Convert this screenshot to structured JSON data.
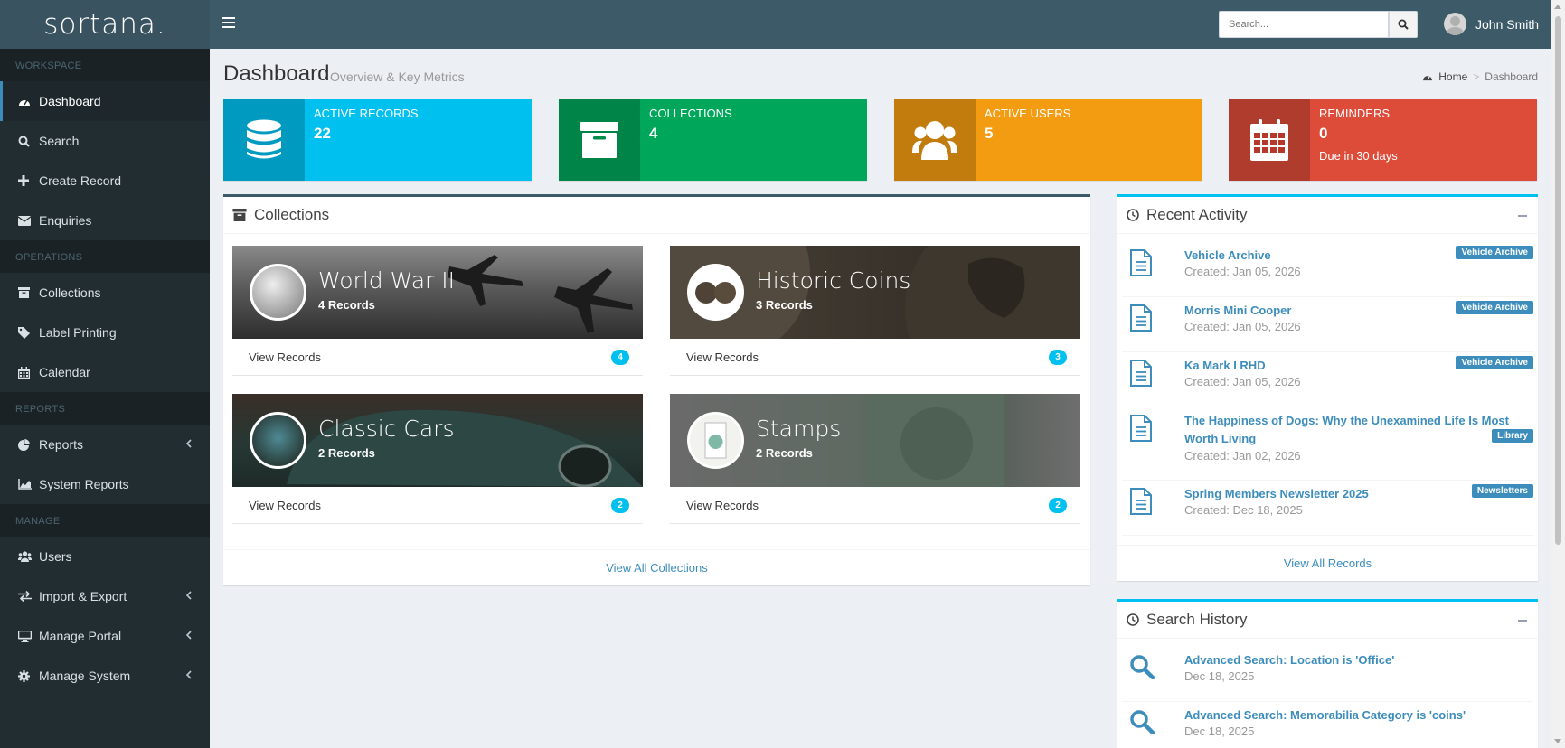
{
  "app": {
    "logo": "sortana."
  },
  "topbar": {
    "search_placeholder": "Search...",
    "user_name": "John Smith"
  },
  "sidebar": {
    "sections": [
      {
        "header": "WORKSPACE",
        "items": [
          {
            "label": "Dashboard",
            "icon": "dashboard-icon",
            "active": true
          },
          {
            "label": "Search",
            "icon": "search-icon"
          },
          {
            "label": "Create Record",
            "icon": "plus-icon"
          },
          {
            "label": "Enquiries",
            "icon": "envelope-icon"
          }
        ]
      },
      {
        "header": "OPERATIONS",
        "items": [
          {
            "label": "Collections",
            "icon": "archive-icon"
          },
          {
            "label": "Label Printing",
            "icon": "tags-icon"
          },
          {
            "label": "Calendar",
            "icon": "calendar-icon"
          }
        ]
      },
      {
        "header": "REPORTS",
        "items": [
          {
            "label": "Reports",
            "icon": "pie-chart-icon",
            "chevron": true
          },
          {
            "label": "System Reports",
            "icon": "area-chart-icon"
          }
        ]
      },
      {
        "header": "MANAGE",
        "items": [
          {
            "label": "Users",
            "icon": "users-icon"
          },
          {
            "label": "Import & Export",
            "icon": "exchange-icon",
            "chevron": true
          },
          {
            "label": "Manage Portal",
            "icon": "desktop-icon",
            "chevron": true
          },
          {
            "label": "Manage System",
            "icon": "gear-icon",
            "chevron": true
          }
        ]
      }
    ]
  },
  "page": {
    "title": "Dashboard",
    "subtitle": "Overview & Key Metrics"
  },
  "breadcrumb": {
    "home": "Home",
    "current": "Dashboard"
  },
  "infoboxes": [
    {
      "label": "ACTIVE RECORDS",
      "value": "22",
      "sub": "",
      "color": "#00c0ef",
      "icon": "database-icon"
    },
    {
      "label": "COLLECTIONS",
      "value": "4",
      "sub": "",
      "color": "#00a65a",
      "icon": "archive-icon"
    },
    {
      "label": "ACTIVE USERS",
      "value": "5",
      "sub": "",
      "color": "#f39c12",
      "icon": "users-icon"
    },
    {
      "label": "REMINDERS",
      "value": "0",
      "sub": "Due in 30 days",
      "color": "#dd4b39",
      "icon": "calendar-icon"
    }
  ],
  "collections": {
    "title": "Collections",
    "view_all": "View All Collections",
    "cards": [
      {
        "name": "World War II",
        "count": "4 Records",
        "link": "View Records",
        "badge": "4"
      },
      {
        "name": "Historic Coins",
        "count": "3 Records",
        "link": "View Records",
        "badge": "3"
      },
      {
        "name": "Classic Cars",
        "count": "2 Records",
        "link": "View Records",
        "badge": "2"
      },
      {
        "name": "Stamps",
        "count": "2 Records",
        "link": "View Records",
        "badge": "2"
      }
    ]
  },
  "recent_activity": {
    "title": "Recent Activity",
    "view_all": "View All Records",
    "items": [
      {
        "title": "Vehicle Archive",
        "date": "Created: Jan 05, 2026",
        "label": "Vehicle Archive"
      },
      {
        "title": "Morris Mini Cooper",
        "date": "Created: Jan 05, 2026",
        "label": "Vehicle Archive"
      },
      {
        "title": "Ka Mark I RHD",
        "date": "Created: Jan 05, 2026",
        "label": "Vehicle Archive"
      },
      {
        "title": "The Happiness of Dogs: Why the Unexamined Life Is Most Worth Living",
        "date": "Created: Jan 02, 2026",
        "label": "Library"
      },
      {
        "title": "Spring Members Newsletter 2025",
        "date": "Created: Dec 18, 2025",
        "label": "Newsletters"
      }
    ]
  },
  "search_history": {
    "title": "Search History",
    "items": [
      {
        "title": "Advanced Search: Location is 'Office'",
        "date": "Dec 18, 2025"
      },
      {
        "title": "Advanced Search: Memorabilia Category is 'coins'",
        "date": "Dec 18, 2025"
      }
    ]
  }
}
